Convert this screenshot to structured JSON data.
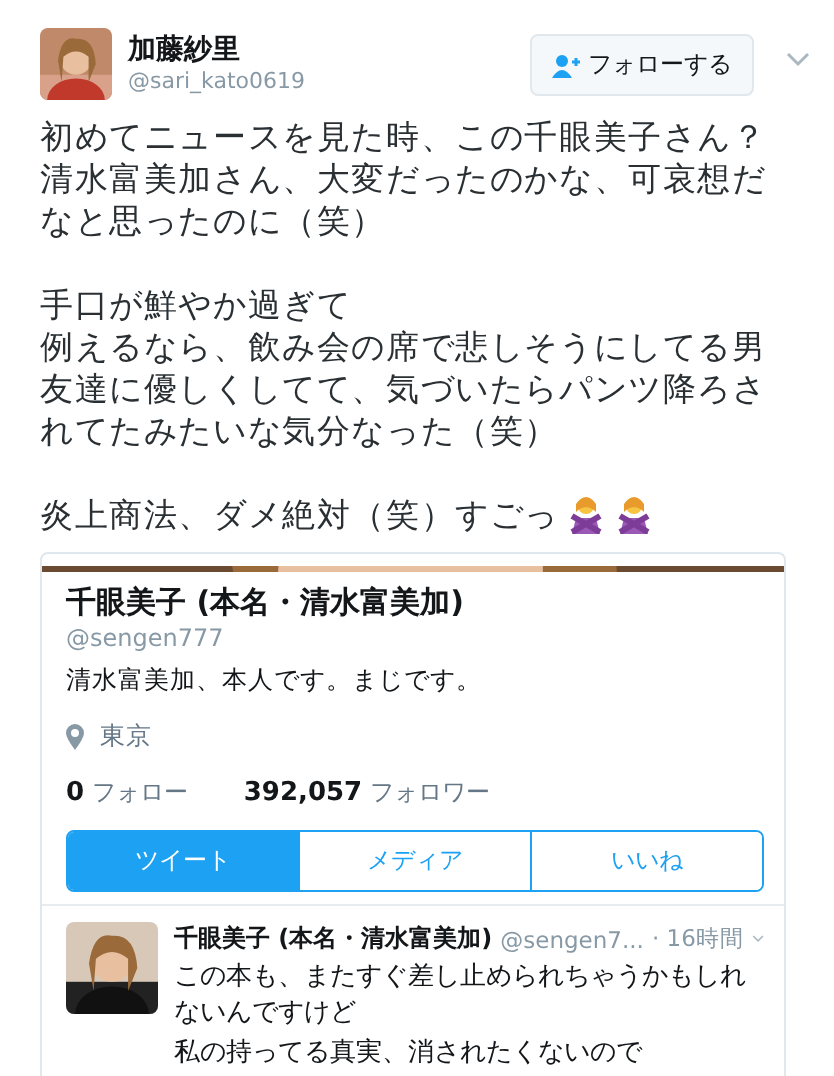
{
  "tweet": {
    "author": {
      "name": "加藤紗里",
      "handle": "@sari_kato0619"
    },
    "follow_button": "フォローする",
    "paragraphs": [
      [
        "初めてニュースを見た時、この千眼美子さん？清水富美加さん、大変だったのかな、可哀想だなと思ったのに（笑）"
      ],
      [
        "手口が鮮やか過ぎて",
        "例えるなら、飲み会の席で悲しそうにしてる男友達に優しくしてて、気づいたらパンツ降ろされてたみたいな気分なった（笑）"
      ],
      [
        "炎上商法、ダメ絶対（笑）すごっ"
      ]
    ]
  },
  "profile_card": {
    "name": "千眼美子 (本名・清水富美加)",
    "handle": "@sengen777",
    "bio": "清水富美加、本人です。まじです。",
    "location": "東京",
    "stats": [
      {
        "value": "0",
        "label": "フォロー"
      },
      {
        "value": "392,057",
        "label": "フォロワー"
      }
    ],
    "tabs": [
      {
        "label": "ツイート",
        "selected": true
      },
      {
        "label": "メディア",
        "selected": false
      },
      {
        "label": "いいね",
        "selected": false
      }
    ],
    "latest_tweet": {
      "name": "千眼美子 (本名・清水富美加)",
      "handle": "@sengen7...",
      "time": "· 16時間",
      "lines": [
        "この本も、またすぐ差し止められちゃうかもしれないんですけど",
        "私の持ってる真実、消されたくないので"
      ]
    }
  }
}
